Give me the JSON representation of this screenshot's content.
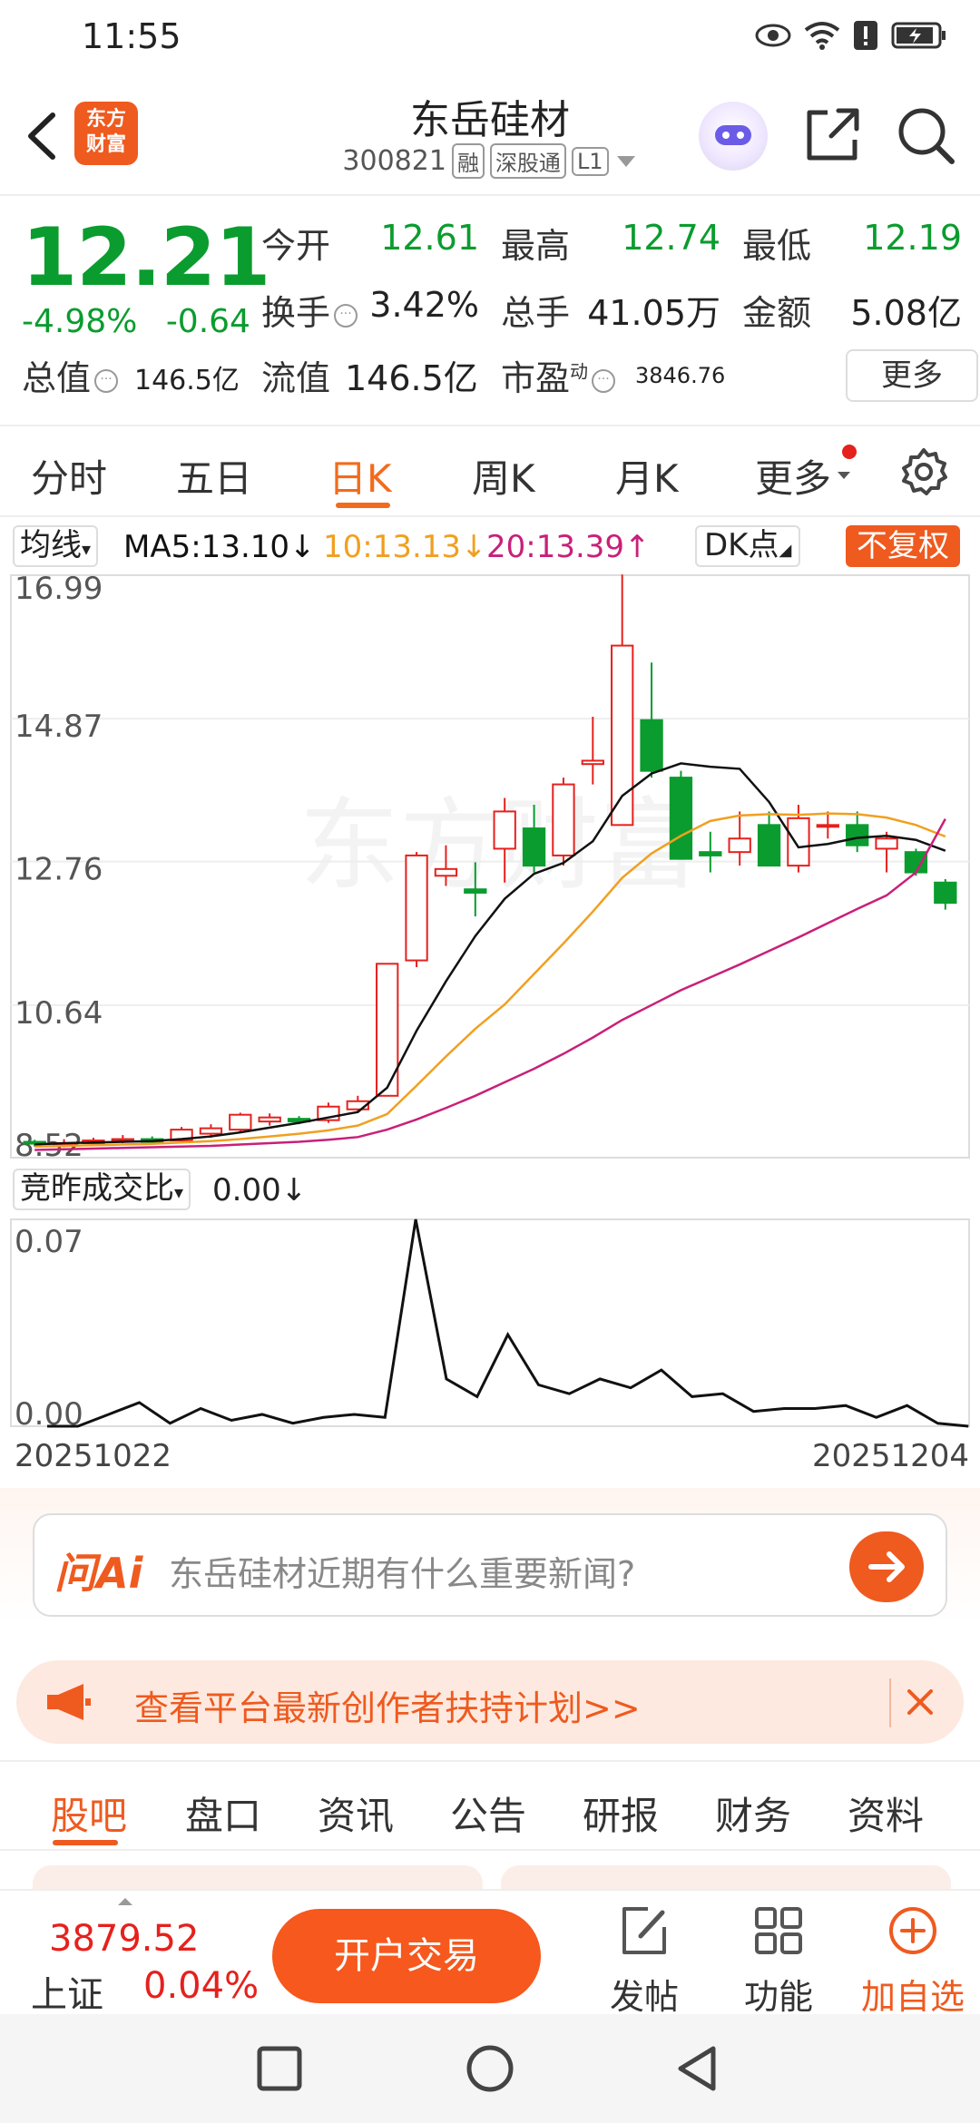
{
  "status": {
    "time": "11:55"
  },
  "header": {
    "title": "东岳硅材",
    "code": "300821",
    "tags": [
      "融",
      "深股通",
      "L1"
    ],
    "logo_line1": "东方",
    "logo_line2": "财富"
  },
  "quote": {
    "price": "12.21",
    "change_pct": "-4.98%",
    "change_amt": "-0.64",
    "open_label": "今开",
    "open": "12.61",
    "high_label": "最高",
    "high": "12.74",
    "low_label": "最低",
    "low": "12.19",
    "turnover_label": "换手",
    "turnover": "3.42%",
    "volume_label": "总手",
    "volume": "41.05万",
    "amount_label": "金额",
    "amount": "5.08亿",
    "mktcap_label": "总值",
    "mktcap": "146.5亿",
    "float_label": "流值",
    "float": "146.5亿",
    "pe_label": "市盈",
    "pe_sup": "动",
    "pe": "3846.76",
    "more": "更多"
  },
  "period_tabs": [
    "分时",
    "五日",
    "日K",
    "周K",
    "月K",
    "更多"
  ],
  "active_period": "日K",
  "ma_legend": {
    "toggle": "均线",
    "ma5": "MA5:13.10↓",
    "ma10": "10:13.13↓",
    "ma20": "20:13.39↑",
    "dk": "DK点",
    "adjust": "不复权",
    "ma5_color": "#111111",
    "ma10_color": "#f0a020",
    "ma20_color": "#c8207a"
  },
  "volume_panel": {
    "label": "竞昨成交比",
    "value": "0.00↓"
  },
  "chart_data": [
    {
      "type": "candlestick",
      "title": "",
      "y_ticks": [
        "16.99",
        "14.87",
        "12.76",
        "10.64",
        "8.52"
      ],
      "ylim": [
        8.52,
        16.99
      ],
      "x_start": "20251022",
      "x_end": "20251204",
      "candles": [
        [
          8.62,
          8.65,
          8.55,
          8.6
        ],
        [
          8.58,
          8.66,
          8.54,
          8.6
        ],
        [
          8.6,
          8.68,
          8.56,
          8.64
        ],
        [
          8.64,
          8.72,
          8.6,
          8.66
        ],
        [
          8.66,
          8.7,
          8.58,
          8.62
        ],
        [
          8.64,
          8.84,
          8.62,
          8.8
        ],
        [
          8.74,
          8.88,
          8.68,
          8.82
        ],
        [
          8.8,
          9.05,
          8.76,
          9.02
        ],
        [
          8.92,
          9.04,
          8.86,
          8.98
        ],
        [
          8.96,
          9.0,
          8.88,
          8.92
        ],
        [
          8.94,
          9.2,
          8.9,
          9.14
        ],
        [
          9.1,
          9.3,
          9.06,
          9.22
        ],
        [
          9.3,
          11.25,
          9.3,
          11.25
        ],
        [
          11.3,
          12.9,
          11.2,
          12.85
        ],
        [
          12.55,
          13.0,
          12.4,
          12.65
        ],
        [
          12.35,
          12.75,
          11.95,
          12.3
        ],
        [
          12.95,
          13.7,
          12.45,
          13.5
        ],
        [
          13.25,
          13.6,
          12.6,
          12.7
        ],
        [
          12.85,
          14.0,
          12.7,
          13.9
        ],
        [
          14.2,
          14.9,
          13.9,
          14.25
        ],
        [
          13.3,
          17.0,
          13.3,
          15.95
        ],
        [
          14.85,
          15.7,
          14.0,
          14.1
        ],
        [
          14.0,
          14.1,
          12.8,
          12.8
        ],
        [
          12.9,
          13.2,
          12.6,
          12.85
        ],
        [
          12.9,
          13.5,
          12.7,
          13.1
        ],
        [
          13.3,
          13.5,
          12.7,
          12.7
        ],
        [
          12.7,
          13.6,
          12.6,
          13.4
        ],
        [
          13.3,
          13.5,
          13.1,
          13.3
        ],
        [
          13.3,
          13.5,
          12.9,
          13.0
        ],
        [
          12.95,
          13.2,
          12.6,
          13.1
        ],
        [
          12.9,
          12.95,
          12.55,
          12.6
        ],
        [
          12.45,
          12.5,
          12.05,
          12.15
        ]
      ],
      "ma5": [
        8.58,
        8.6,
        8.61,
        8.62,
        8.63,
        8.66,
        8.7,
        8.76,
        8.83,
        8.9,
        8.98,
        9.06,
        9.42,
        10.26,
        10.99,
        11.66,
        12.21,
        12.58,
        12.74,
        13.06,
        13.73,
        14.06,
        14.21,
        14.16,
        14.13,
        13.64,
        12.97,
        13.02,
        13.11,
        13.14,
        13.08,
        12.92
      ],
      "ma10": [
        8.55,
        8.56,
        8.57,
        8.58,
        8.59,
        8.61,
        8.63,
        8.66,
        8.7,
        8.74,
        8.79,
        8.86,
        9.03,
        9.45,
        9.88,
        10.29,
        10.65,
        11.1,
        11.55,
        12.02,
        12.52,
        12.88,
        13.14,
        13.36,
        13.44,
        13.46,
        13.45,
        13.47,
        13.46,
        13.41,
        13.3,
        13.13
      ],
      "ma20": [
        8.5,
        8.51,
        8.52,
        8.53,
        8.54,
        8.55,
        8.56,
        8.58,
        8.6,
        8.62,
        8.65,
        8.69,
        8.8,
        8.95,
        9.12,
        9.3,
        9.5,
        9.7,
        9.92,
        10.16,
        10.42,
        10.64,
        10.86,
        11.05,
        11.24,
        11.44,
        11.64,
        11.85,
        12.06,
        12.26,
        12.6,
        13.39
      ]
    },
    {
      "type": "line",
      "title": "",
      "y_ticks": [
        "0.07",
        "0.00"
      ],
      "ylim": [
        0,
        0.07
      ],
      "values": [
        0.0,
        0.0,
        0.004,
        0.008,
        0.001,
        0.006,
        0.002,
        0.004,
        0.001,
        0.003,
        0.004,
        0.003,
        0.07,
        0.016,
        0.01,
        0.031,
        0.014,
        0.011,
        0.016,
        0.013,
        0.019,
        0.01,
        0.011,
        0.005,
        0.006,
        0.006,
        0.007,
        0.003,
        0.007,
        0.001,
        0.0
      ]
    }
  ],
  "ai_bar": {
    "logo": "问Ai",
    "placeholder": "东岳硅材近期有什么重要新闻?"
  },
  "promo": {
    "text": "查看平台最新创作者扶持计划>>"
  },
  "content_tabs": [
    "股吧",
    "盘口",
    "资讯",
    "公告",
    "研报",
    "财务",
    "资料"
  ],
  "active_content_tab": "股吧",
  "trade_bar": {
    "index_value": "3879.52",
    "index_name": "上证",
    "index_pct": "0.04%",
    "open_account": "开户交易",
    "post": "发帖",
    "functions": "功能",
    "add_watch": "加自选"
  }
}
